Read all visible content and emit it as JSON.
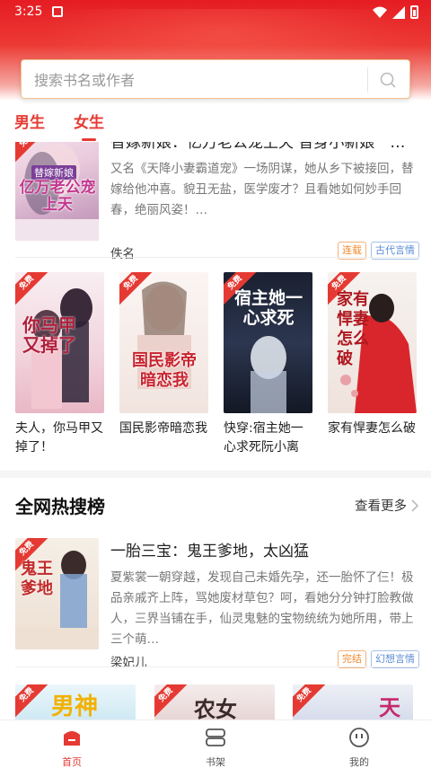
{
  "status_bar": {
    "time": "3:25"
  },
  "search": {
    "placeholder": "搜索书名或作者",
    "value": ""
  },
  "gender_tabs": [
    {
      "label": "男生",
      "active": false
    },
    {
      "label": "女生",
      "active": true
    }
  ],
  "book_list_top": {
    "title": "替嫁新娘：亿万老公宠上天 替身小新娘一胎俏总裁",
    "desc": "又名《天降小妻霸道宠》一场阴谋，她从乡下被接回，替嫁给他冲喜。貌丑无盐，医学废才？且看她如何妙手回春，绝丽风姿！…",
    "author": "佚名",
    "tags": [
      "连载",
      "古代言情"
    ],
    "cover_badge": "免费",
    "cover_title": "亿万老公宠上天",
    "cover_sub": "替嫁新娘"
  },
  "grid_books": [
    {
      "title": "夫人，你马甲又掉了！",
      "badge": "免费",
      "cover_text": "你马甲又掉了"
    },
    {
      "title": "国民影帝暗恋我",
      "badge": "免费",
      "cover_text": "国民影帝暗恋我"
    },
    {
      "title": "快穿:宿主她一心求死阮小离",
      "badge": "免费",
      "cover_text": "宿主她一心求死"
    },
    {
      "title": "家有悍妻怎么破",
      "badge": "免费",
      "cover_text": "家有悍妻怎么破"
    }
  ],
  "hot_section": {
    "title": "全网热搜榜",
    "more_label": "查看更多"
  },
  "book_list_second": {
    "title": "一胎三宝：鬼王爹地，太凶猛",
    "desc": "夏紫裳一朝穿越，发现自己未婚先孕，还一胎怀了仨！极品亲戚齐上阵，骂她废材草包？呵，看她分分钟打脸教做人，三界当铺在手，仙灵鬼魅的宝物统统为她所用，带上三个萌…",
    "author": "梁妃儿",
    "tags": [
      "完结",
      "幻想言情"
    ],
    "cover_badge": "免费",
    "cover_title": "鬼王爹地"
  },
  "bottom_covers": [
    {
      "badge": "免费",
      "cover_text": "男神"
    },
    {
      "badge": "免费",
      "cover_text": "农女"
    },
    {
      "badge": "免费",
      "cover_text": "天"
    }
  ],
  "bottom_nav": [
    {
      "label": "首页",
      "active": true
    },
    {
      "label": "书架",
      "active": false
    },
    {
      "label": "我的",
      "active": false
    }
  ],
  "colors": {
    "accent": "#e53a33",
    "header_top": "#e51c23",
    "tag_orange": "#f08a2c",
    "tag_blue": "#5a8bd6"
  }
}
